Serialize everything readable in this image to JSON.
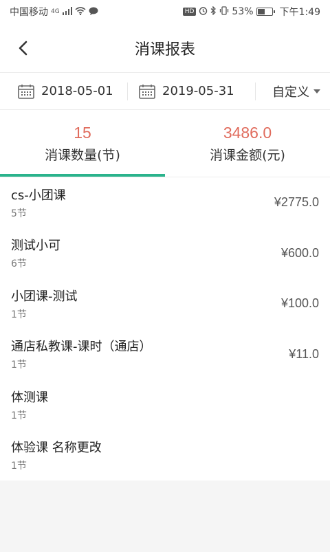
{
  "status_bar": {
    "carrier": "中国移动",
    "network": "4G",
    "hd": "HD",
    "battery_text": "53%",
    "battery_level": 0.53,
    "time": "下午1:49"
  },
  "header": {
    "title": "消课报表"
  },
  "filters": {
    "start_date": "2018-05-01",
    "end_date": "2019-05-31",
    "range_mode": "自定义"
  },
  "summary": {
    "count_value": "15",
    "count_label": "消课数量(节)",
    "amount_value": "3486.0",
    "amount_label": "消课金额(元)"
  },
  "courses": [
    {
      "name": "cs-小团课",
      "count": "5节",
      "amount": "¥2775.0"
    },
    {
      "name": "测试小可",
      "count": "6节",
      "amount": "¥600.0"
    },
    {
      "name": "小团课-测试",
      "count": "1节",
      "amount": "¥100.0"
    },
    {
      "name": "通店私教课-课时（通店）",
      "count": "1节",
      "amount": "¥11.0"
    },
    {
      "name": "体测课",
      "count": "1节",
      "amount": ""
    },
    {
      "name": "体验课 名称更改",
      "count": "1节",
      "amount": ""
    }
  ],
  "colors": {
    "accent": "#2bb38c",
    "value_red": "#e06b5c"
  }
}
